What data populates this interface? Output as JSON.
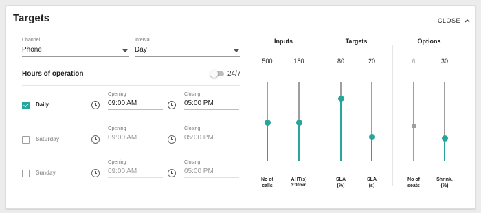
{
  "card": {
    "title": "Targets",
    "close_label": "CLOSE"
  },
  "channel": {
    "label": "Channel",
    "value": "Phone"
  },
  "interval": {
    "label": "Interval",
    "value": "Day"
  },
  "hours": {
    "title": "Hours of operation",
    "toggle_label": "24/7",
    "toggle_on": false,
    "days": [
      {
        "name": "Daily",
        "checked": true,
        "opening_label": "Opening",
        "opening": "09:00 AM",
        "closing_label": "Closing",
        "closing": "05:00 PM"
      },
      {
        "name": "Saturday",
        "checked": false,
        "opening_label": "Opening",
        "opening": "09:00 AM",
        "closing_label": "Closing",
        "closing": "05:00 PM"
      },
      {
        "name": "Sunday",
        "checked": false,
        "opening_label": "Opening",
        "opening": "09:00 AM",
        "closing_label": "Closing",
        "closing": "05:00 PM"
      }
    ]
  },
  "groups": [
    {
      "title": "Inputs"
    },
    {
      "title": "Targets"
    },
    {
      "title": "Options"
    }
  ],
  "sliders": [
    {
      "value": "500",
      "label": "No of",
      "label2": "calls",
      "sub": "",
      "level": 0.49,
      "enabled": true
    },
    {
      "value": "180",
      "label": "AHT(s)",
      "label2": "",
      "sub": "3:00min",
      "level": 0.49,
      "enabled": true
    },
    {
      "value": "80",
      "label": "SLA",
      "label2": "(%)",
      "sub": "",
      "level": 0.8,
      "enabled": true
    },
    {
      "value": "20",
      "label": "SLA",
      "label2": "(s)",
      "sub": "",
      "level": 0.31,
      "enabled": true
    },
    {
      "value": "6",
      "label": "No of",
      "label2": "seats",
      "sub": "",
      "level": 0.45,
      "enabled": false
    },
    {
      "value": "30",
      "label": "Shrink.",
      "label2": "(%)",
      "sub": "",
      "level": 0.29,
      "enabled": true
    }
  ],
  "colors": {
    "accent": "#26a69a",
    "disabled_thumb": "#9e9e9e",
    "track_inactive": "#9e9e9e"
  },
  "icons": {
    "close": "chevron-up-icon",
    "time": "clock-icon",
    "dropdown": "caret-down-icon"
  }
}
